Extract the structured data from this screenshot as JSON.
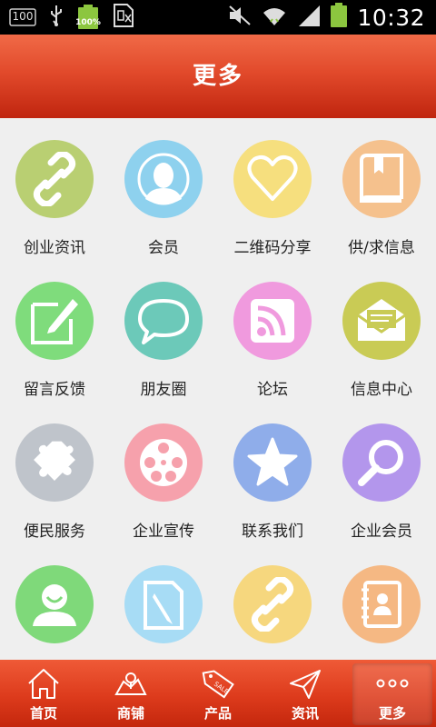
{
  "status_bar": {
    "notification_badge": "100",
    "battery_percent_label": "100%",
    "time": "10:32",
    "battery_level": 1.0,
    "icons": [
      "notification-100-icon",
      "usb-icon",
      "battery-full-icon",
      "sim-icon",
      "mute-icon",
      "wifi-icon",
      "signal-icon",
      "battery-icon"
    ]
  },
  "title_bar": {
    "title": "更多",
    "color": "#e24a2b"
  },
  "grid": {
    "items": [
      {
        "label": "创业资讯",
        "icon": "link-icon",
        "color": "#b9cf72"
      },
      {
        "label": "会员",
        "icon": "member-avatar-icon",
        "color": "#8ed1ee"
      },
      {
        "label": "二维码分享",
        "icon": "heart-icon",
        "color": "#f6df7e"
      },
      {
        "label": "供/求信息",
        "icon": "book-icon",
        "color": "#f5c18d"
      },
      {
        "label": "留言反馈",
        "icon": "edit-note-icon",
        "color": "#7fdc7c"
      },
      {
        "label": "朋友圈",
        "icon": "chat-bubble-icon",
        "color": "#6cc9b9"
      },
      {
        "label": "论坛",
        "icon": "rss-icon",
        "color": "#f09ade"
      },
      {
        "label": "信息中心",
        "icon": "mail-icon",
        "color": "#c9cb55"
      },
      {
        "label": "便民服务",
        "icon": "puzzle-icon",
        "color": "#bfc4cb"
      },
      {
        "label": "企业宣传",
        "icon": "film-reel-icon",
        "color": "#f6a1ac"
      },
      {
        "label": "联系我们",
        "icon": "star-icon",
        "color": "#8fadea"
      },
      {
        "label": "企业会员",
        "icon": "magnifier-icon",
        "color": "#b396ec"
      },
      {
        "label": "",
        "icon": "smiling-user-icon",
        "color": "#7fd97a"
      },
      {
        "label": "",
        "icon": "document-pencil-icon",
        "color": "#a7dcf5"
      },
      {
        "label": "",
        "icon": "link-icon",
        "color": "#f6d77e"
      },
      {
        "label": "",
        "icon": "contact-book-icon",
        "color": "#f5b883"
      }
    ]
  },
  "bottom_nav": {
    "items": [
      {
        "label": "首页",
        "icon": "home-icon",
        "active": false
      },
      {
        "label": "商铺",
        "icon": "shop-map-icon",
        "active": false
      },
      {
        "label": "产品",
        "icon": "sale-tag-icon",
        "active": false
      },
      {
        "label": "资讯",
        "icon": "paper-plane-icon",
        "active": false
      },
      {
        "label": "更多",
        "icon": "more-dots-icon",
        "active": true
      }
    ]
  }
}
